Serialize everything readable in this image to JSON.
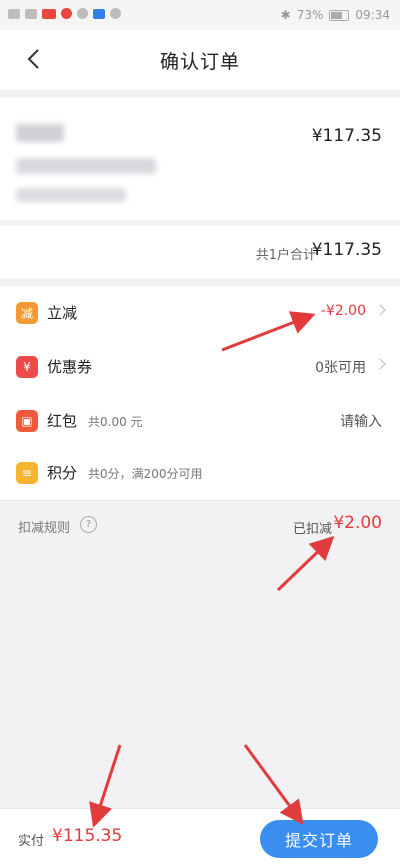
{
  "status_bar": {
    "battery": "73%",
    "time": "09:34"
  },
  "header": {
    "title": "确认订单"
  },
  "product": {
    "price": "¥117.35"
  },
  "summary": {
    "label": "共1户合计",
    "value": "¥117.35"
  },
  "discounts": [
    {
      "icon": "立减",
      "icon_color": "#f39a34",
      "label": "立减",
      "sub": "",
      "value": "-¥2.00",
      "value_style": "red",
      "chevron": true
    },
    {
      "icon": "券",
      "icon_color": "#ef4a4a",
      "label": "优惠券",
      "sub": "",
      "value": "0张可用",
      "value_style": "normal",
      "chevron": true
    },
    {
      "icon": "包",
      "icon_color": "#f05a3a",
      "label": "红包",
      "sub": "共0.00 元",
      "value": "请输入",
      "value_style": "plain",
      "chevron": false
    },
    {
      "icon": "积",
      "icon_color": "#f5b52e",
      "label": "积分",
      "sub": "共0分，满200分可用",
      "value": "",
      "value_style": "plain",
      "chevron": false
    }
  ],
  "rules": {
    "label": "扣减规则",
    "help": "?",
    "deducted_label": "已扣减",
    "deducted_value": "¥2.00"
  },
  "footer": {
    "pay_label": "实付",
    "pay_value": "¥115.35",
    "submit_label": "提交订单"
  },
  "colors": {
    "accent_red": "#e5383b",
    "button_blue": "#3a8ef0",
    "annotation_red": "#e23b3b"
  }
}
